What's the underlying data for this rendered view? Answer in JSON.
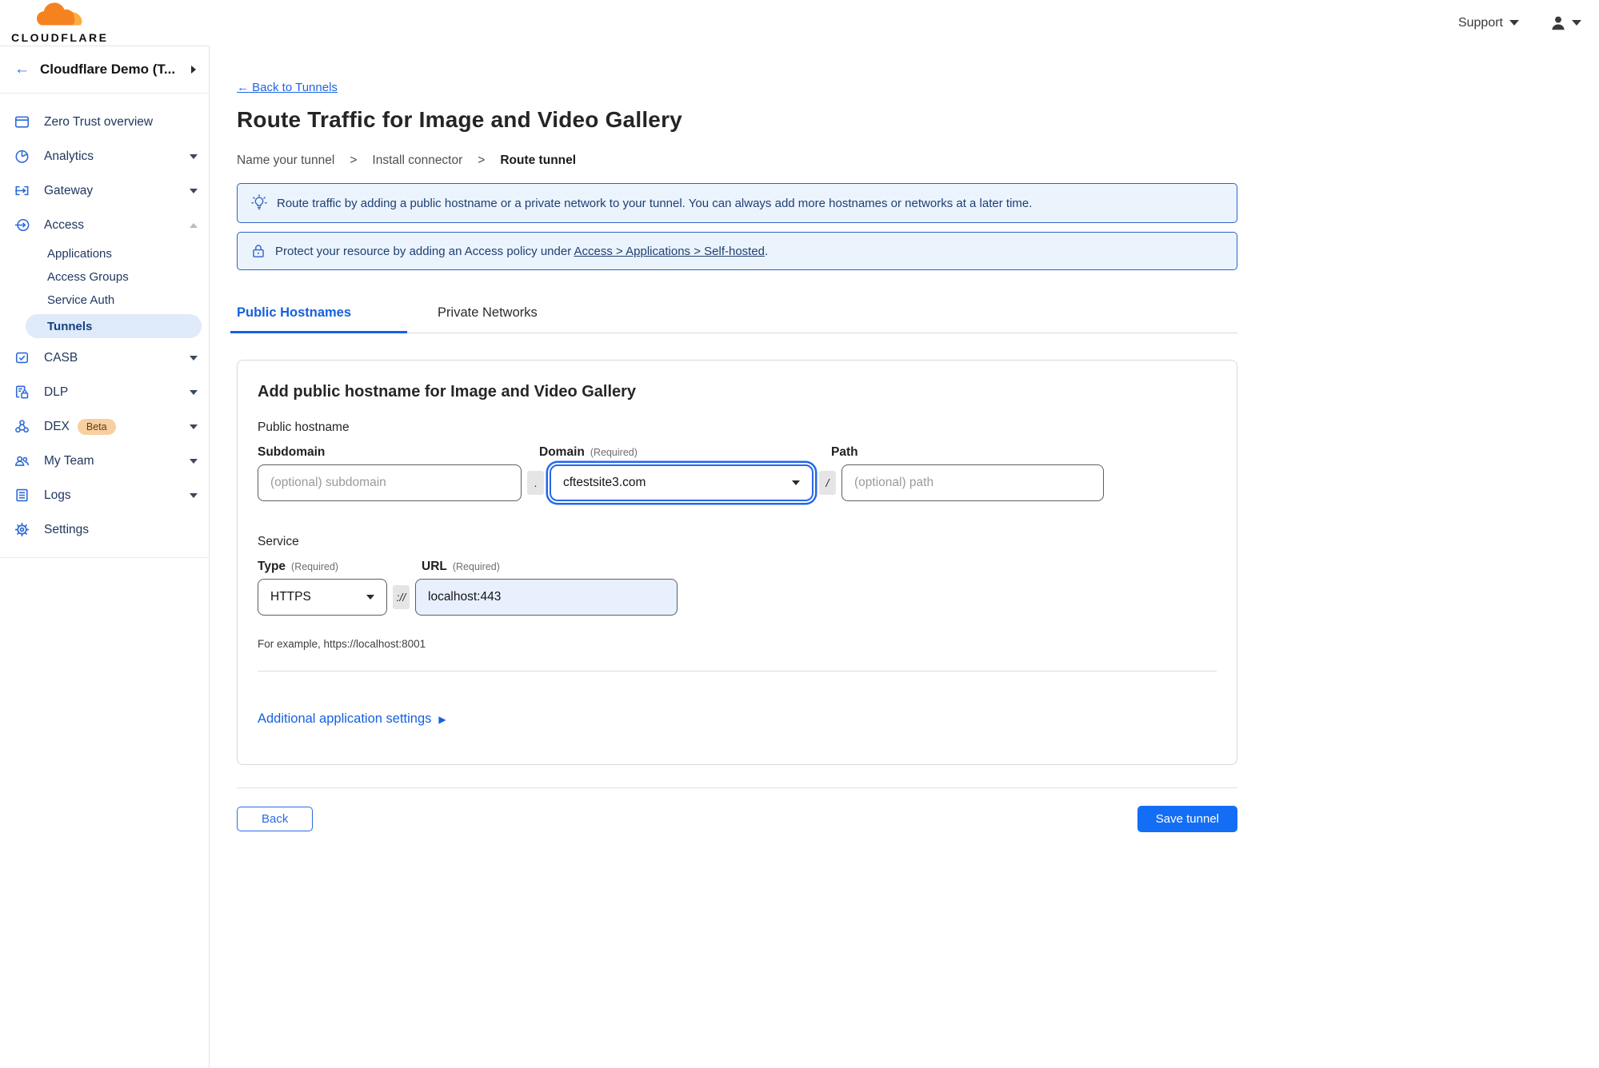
{
  "colors": {
    "accent_blue": "#1660e0",
    "save_button_blue": "#146ef5",
    "banner_border": "#2e63c6",
    "banner_bg": "#ebf3fc",
    "banner_text": "#1f3f73",
    "sidebar_active_bg": "#dfeafb",
    "beta_badge_bg": "#f8cfa0",
    "logo_orange": "#f6821f",
    "url_autofill_bg": "#e8f0fe"
  },
  "header": {
    "logo_word": "CLOUDFLARE",
    "support_label": "Support",
    "icons": {
      "support_caret": "chevron-down-icon",
      "user": "person-icon",
      "user_caret": "chevron-down-icon"
    }
  },
  "sidebar": {
    "back_glyph": "←",
    "account_label": "Cloudflare Demo (T...",
    "items": [
      {
        "label": "Zero Trust overview",
        "icon": "window-icon",
        "chevron": "none"
      },
      {
        "label": "Analytics",
        "icon": "pie-chart-icon",
        "chevron": "down"
      },
      {
        "label": "Gateway",
        "icon": "gateway-icon",
        "chevron": "down"
      },
      {
        "label": "Access",
        "icon": "access-icon",
        "chevron": "up"
      },
      {
        "label": "CASB",
        "icon": "casb-check-icon",
        "chevron": "down"
      },
      {
        "label": "DLP",
        "icon": "document-lock-icon",
        "chevron": "down"
      },
      {
        "label": "DEX",
        "icon": "network-nodes-icon",
        "chevron": "down",
        "badge": "Beta"
      },
      {
        "label": "My Team",
        "icon": "people-icon",
        "chevron": "down"
      },
      {
        "label": "Logs",
        "icon": "list-document-icon",
        "chevron": "down"
      },
      {
        "label": "Settings",
        "icon": "gear-icon",
        "chevron": "none"
      }
    ],
    "access_children": [
      {
        "label": "Applications",
        "active": false
      },
      {
        "label": "Access Groups",
        "active": false
      },
      {
        "label": "Service Auth",
        "active": false
      },
      {
        "label": "Tunnels",
        "active": true
      }
    ]
  },
  "main": {
    "back_link": "← Back to Tunnels",
    "title": "Route Traffic for Image and Video Gallery",
    "breadcrumb": [
      "Name your tunnel",
      "Install connector",
      "Route tunnel"
    ],
    "breadcrumb_sep": ">",
    "banners": [
      {
        "icon": "lightbulb-icon",
        "text": "Route traffic by adding a public hostname or a private network to your tunnel. You can always add more hostnames or networks at a later time."
      },
      {
        "icon": "lock-icon",
        "text_prefix": "Protect your resource by adding an Access policy under ",
        "link_text": "Access > Applications > Self-hosted",
        "text_suffix": "."
      }
    ],
    "tabs": [
      {
        "label": "Public Hostnames",
        "active": true
      },
      {
        "label": "Private Networks",
        "active": false
      }
    ],
    "form": {
      "heading": "Add public hostname for Image and Video Gallery",
      "public_hostname_label": "Public hostname",
      "subdomain": {
        "label": "Subdomain",
        "placeholder": "(optional) subdomain",
        "value": ""
      },
      "dot_separator": ".",
      "domain": {
        "label": "Domain",
        "required_hint": "(Required)",
        "value": "cftestsite3.com"
      },
      "slash_separator": "/",
      "path": {
        "label": "Path",
        "placeholder": "(optional) path",
        "value": ""
      },
      "service_label": "Service",
      "type": {
        "label": "Type",
        "required_hint": "(Required)",
        "value": "HTTPS"
      },
      "scheme_separator": "://",
      "url": {
        "label": "URL",
        "required_hint": "(Required)",
        "value": "localhost:443"
      },
      "example_hint": "For example, https://localhost:8001",
      "additional_settings_label": "Additional application settings",
      "additional_settings_caret": "▶"
    },
    "footer": {
      "back_label": "Back",
      "save_label": "Save tunnel"
    }
  }
}
